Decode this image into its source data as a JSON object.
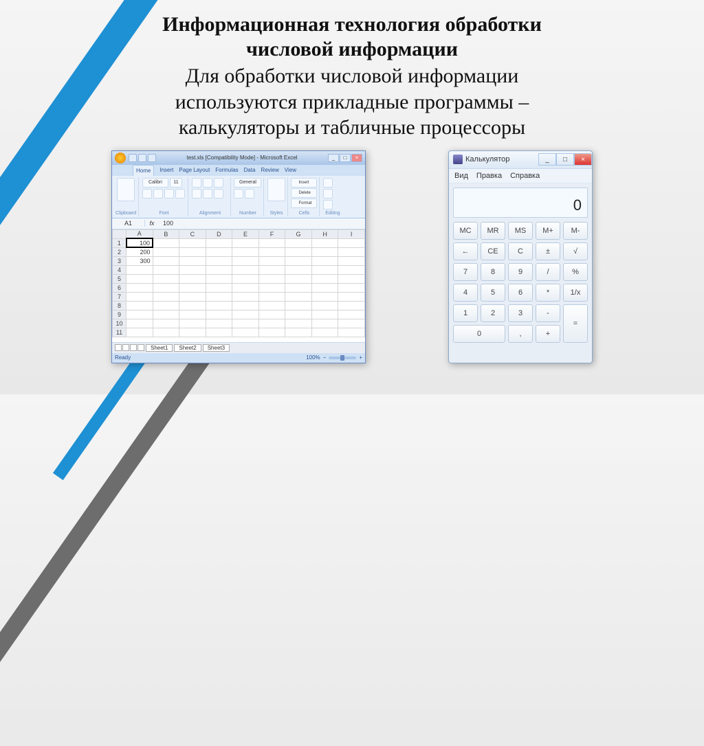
{
  "heading": {
    "title_line1": "Информационная технология обработки",
    "title_line2": "числовой информации",
    "sub_line1": "Для обработки числовой информации",
    "sub_line2": "используются прикладные программы –",
    "sub_line3": "калькуляторы и табличные процессоры"
  },
  "excel": {
    "caption": "test.xls [Compatibility Mode] - Microsoft Excel",
    "tabs": [
      "Home",
      "Insert",
      "Page Layout",
      "Formulas",
      "Data",
      "Review",
      "View"
    ],
    "groups": {
      "clipboard": "Clipboard",
      "font": "Font",
      "font_name": "Calibri",
      "font_size": "11",
      "alignment": "Alignment",
      "number": "Number",
      "number_fmt": "General",
      "styles": "Styles",
      "cells": "Cells",
      "cells_insert": "Insert",
      "cells_delete": "Delete",
      "cells_format": "Format",
      "editing": "Editing"
    },
    "namebox": "A1",
    "fx": "fx",
    "formula_value": "100",
    "columns": [
      "A",
      "B",
      "C",
      "D",
      "E",
      "F",
      "G",
      "H",
      "I"
    ],
    "rows": [
      "1",
      "2",
      "3",
      "4",
      "5",
      "6",
      "7",
      "8",
      "9",
      "10",
      "11"
    ],
    "cells": {
      "A1": "100",
      "A2": "200",
      "A3": "300"
    },
    "sheets": [
      "Sheet1",
      "Sheet2",
      "Sheet3"
    ],
    "status": "Ready",
    "zoom": "100%"
  },
  "calc": {
    "title": "Калькулятор",
    "menu": [
      "Вид",
      "Правка",
      "Справка"
    ],
    "display": "0",
    "buttons": [
      [
        "MC",
        "MR",
        "MS",
        "M+",
        "M-"
      ],
      [
        "←",
        "CE",
        "C",
        "±",
        "√"
      ],
      [
        "7",
        "8",
        "9",
        "/",
        "%"
      ],
      [
        "4",
        "5",
        "6",
        "*",
        "1/x"
      ],
      [
        "1",
        "2",
        "3",
        "-",
        "="
      ],
      [
        "0",
        ",",
        "+"
      ]
    ]
  }
}
